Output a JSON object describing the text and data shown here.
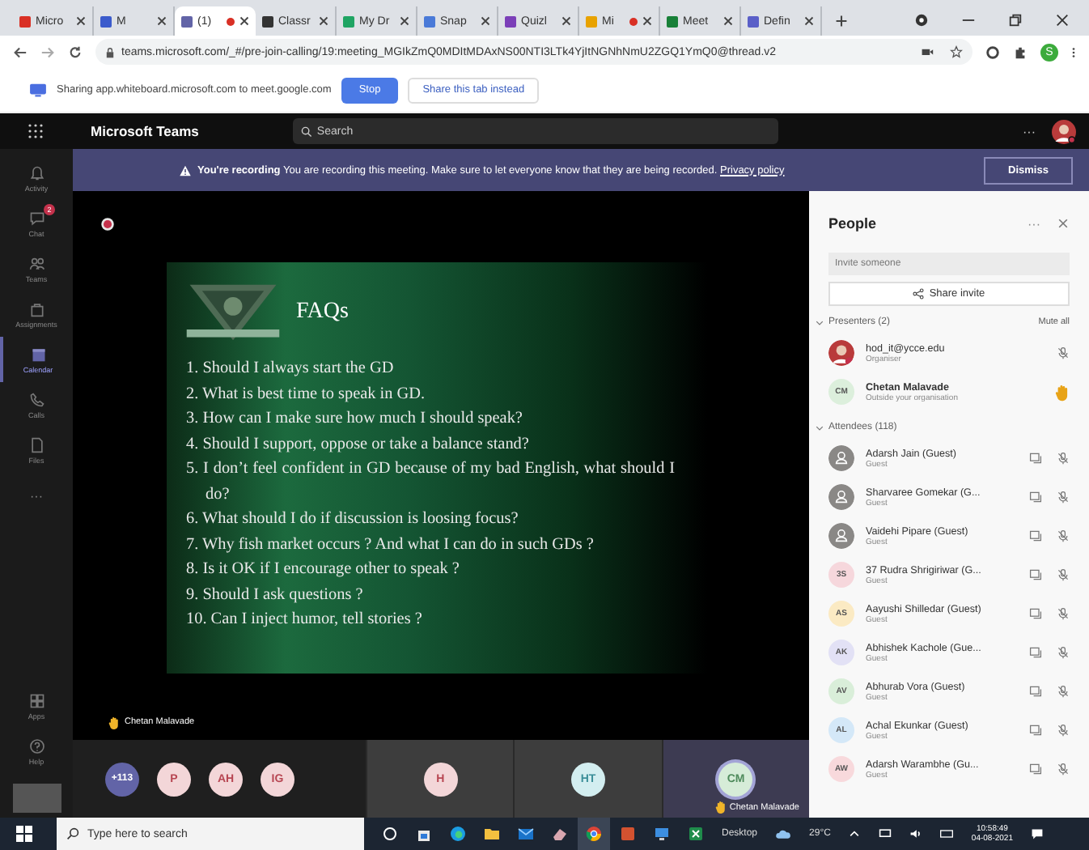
{
  "browser": {
    "tabs": [
      {
        "title": "Micro",
        "selected": false,
        "recording": false
      },
      {
        "title": "M",
        "selected": false,
        "recording": false
      },
      {
        "title": "(1)",
        "selected": true,
        "recording": true
      },
      {
        "title": "Classr",
        "selected": false,
        "recording": false
      },
      {
        "title": "My Dr",
        "selected": false,
        "recording": false
      },
      {
        "title": "Snap",
        "selected": false,
        "recording": false
      },
      {
        "title": "Quizl",
        "selected": false,
        "recording": false
      },
      {
        "title": "Mi",
        "selected": false,
        "recording": true
      },
      {
        "title": "Meet",
        "selected": false,
        "recording": false
      },
      {
        "title": "Defin",
        "selected": false,
        "recording": false
      }
    ],
    "url": "teams.microsoft.com/_#/pre-join-calling/19:meeting_MGIkZmQ0MDItMDAxNS00NTI3LTk4YjItNGNhNmU2ZGQ1YmQ0@thread.v2",
    "profile_initial": "S",
    "sharing": {
      "message": "Sharing app.whiteboard.microsoft.com to meet.google.com",
      "stop": "Stop",
      "share_tab": "Share this tab instead"
    }
  },
  "teams": {
    "app_name": "Microsoft Teams",
    "search_placeholder": "Search",
    "more": "···",
    "rail": [
      {
        "kind": "app",
        "label": "Activity",
        "selected": false
      },
      {
        "kind": "app",
        "label": "Chat",
        "selected": false,
        "badge": "2"
      },
      {
        "kind": "app",
        "label": "Teams",
        "selected": false
      },
      {
        "kind": "app",
        "label": "Assignments",
        "selected": false
      },
      {
        "kind": "app",
        "label": "Calendar",
        "selected": true
      },
      {
        "kind": "app",
        "label": "Calls",
        "selected": false
      },
      {
        "kind": "app",
        "label": "Files",
        "selected": false
      },
      {
        "kind": "more",
        "label": "···",
        "selected": false
      }
    ],
    "rail_bottom": [
      {
        "label": "Apps"
      },
      {
        "label": "Help"
      }
    ],
    "banner": {
      "lead": "You're recording",
      "message": "You are recording this meeting. Make sure to let everyone know that they are being recorded.",
      "link": "Privacy policy",
      "dismiss": "Dismiss"
    },
    "slide": {
      "title": "FAQs",
      "items": [
        "1. Should I always start the GD",
        "2. What is best time to speak in GD.",
        "3. How can I make sure how much I should speak?",
        "4. Should I support, oppose or take a balance stand?",
        "5. I don’t feel confident in GD because of my bad English, what should I do?",
        "6. What should I do if discussion is loosing focus?",
        "7. Why fish market occurs ? And what I can do in such GDs ?",
        "8. Is it OK if I encourage other to speak ?",
        "9. Should I ask questions ?",
        "10. Can I inject humor, tell stories ?"
      ]
    },
    "presenter_label": {
      "name": "Chetan Malavade",
      "hand_raised": true
    },
    "strip": {
      "avatars": [
        {
          "label": "+113",
          "color": "#6264a7"
        },
        {
          "label": "P",
          "color": "#f3d6d8"
        },
        {
          "label": "AH",
          "color": "#f3d6d8"
        },
        {
          "label": "IG",
          "color": "#f3d6d8"
        }
      ],
      "tiles": [
        {
          "initials": "H",
          "color": "#f3d6d8",
          "speaking": false
        },
        {
          "initials": "HT",
          "color": "#d3eef0",
          "speaking": false
        },
        {
          "initials": "CM",
          "color": "#d6ecd8",
          "speaking": true,
          "name": "Chetan Malavade",
          "hand_raised": true
        }
      ]
    },
    "people": {
      "title": "People",
      "invite_placeholder": "Invite someone",
      "share_invite": "Share invite",
      "presenters": {
        "heading": "Presenters (2)",
        "mute_all": "Mute all",
        "expanded": true,
        "members": [
          {
            "kind": "photo",
            "name": "hod_it@ycce.edu",
            "role": "Organiser",
            "bold": false,
            "hand_raised": false
          },
          {
            "kind": "initials",
            "initials": "CM",
            "color": "#dcefdc",
            "name": "Chetan Malavade",
            "role": "Outside your organisation",
            "bold": true,
            "hand_raised": true
          }
        ]
      },
      "attendees": {
        "heading": "Attendees (118)",
        "expanded": true,
        "members": [
          {
            "kind": "guest",
            "name": "Adarsh Jain (Guest)",
            "role": "Guest"
          },
          {
            "kind": "guest",
            "name": "Sharvaree Gomekar (G...",
            "role": "Guest"
          },
          {
            "kind": "guest",
            "name": "Vaidehi Pipare (Guest)",
            "role": "Guest"
          },
          {
            "kind": "initials",
            "initials": "3S",
            "color": "#f6d7dc",
            "name": "37 Rudra Shrigiriwar (G...",
            "role": "Guest"
          },
          {
            "kind": "initials",
            "initials": "AS",
            "color": "#fbeac3",
            "name": "Aayushi Shilledar (Guest)",
            "role": "Guest"
          },
          {
            "kind": "initials",
            "initials": "AK",
            "color": "#e2e1f5",
            "name": "Abhishek Kachole (Gue...",
            "role": "Guest"
          },
          {
            "kind": "initials",
            "initials": "AV",
            "color": "#d9eed9",
            "name": "Abhurab Vora (Guest)",
            "role": "Guest"
          },
          {
            "kind": "initials",
            "initials": "AL",
            "color": "#d4e8f8",
            "name": "Achal Ekunkar (Guest)",
            "role": "Guest"
          },
          {
            "kind": "initials",
            "initials": "AW",
            "color": "#f8d9dc",
            "name": "Adarsh Warambhe (Gu...",
            "role": "Guest"
          }
        ]
      }
    }
  },
  "taskbar": {
    "search_placeholder": "Type here to search",
    "desktop": "Desktop",
    "temperature": "29°C",
    "time": "10:58:49",
    "date": "04-08-2021"
  }
}
